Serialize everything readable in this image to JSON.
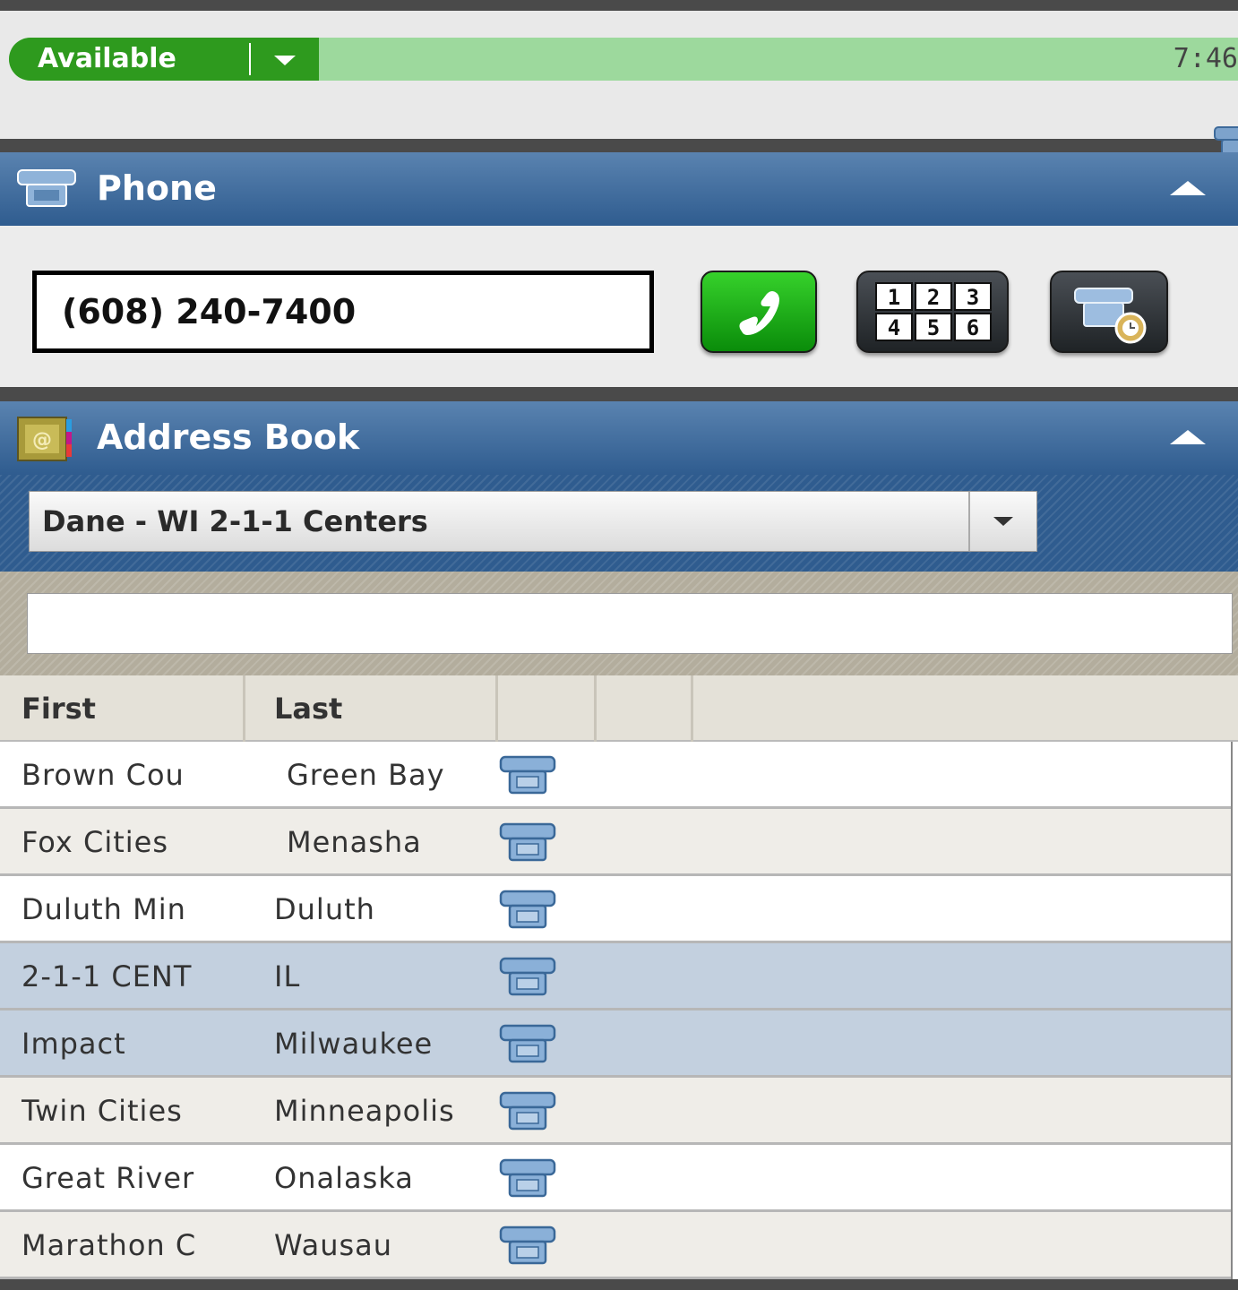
{
  "status": {
    "state": "Available",
    "time": "7:46",
    "colors": {
      "pill": "#2e9a1e",
      "bar": "#9dd99d"
    }
  },
  "phone": {
    "title": "Phone",
    "dial_value": "(608) 240-7400",
    "buttons": [
      "call-button",
      "keypad-button",
      "call-history-button"
    ],
    "keypad_digits": [
      "1",
      "2",
      "3",
      "4",
      "5",
      "6"
    ]
  },
  "address_book": {
    "title": "Address Book",
    "selected_book": "Dane - WI 2-1-1 Centers",
    "search_value": "",
    "columns": [
      "First",
      "Last",
      "",
      "",
      ""
    ],
    "rows": [
      {
        "first": "Brown Cou",
        "last": "Green Bay",
        "indent": true,
        "style": "odd"
      },
      {
        "first": "Fox Cities",
        "last": "Menasha",
        "indent": true,
        "style": "even"
      },
      {
        "first": "Duluth Min",
        "last": "Duluth",
        "indent": false,
        "style": "odd"
      },
      {
        "first": "2-1-1 CENT",
        "last": "IL",
        "indent": false,
        "style": "selected"
      },
      {
        "first": "Impact",
        "last": "Milwaukee",
        "indent": false,
        "style": "selected"
      },
      {
        "first": "Twin Cities",
        "last": "Minneapolis",
        "indent": false,
        "style": "even"
      },
      {
        "first": "Great River",
        "last": "Onalaska",
        "indent": false,
        "style": "odd"
      },
      {
        "first": "Marathon C",
        "last": "Wausau",
        "indent": false,
        "style": "even"
      }
    ]
  }
}
